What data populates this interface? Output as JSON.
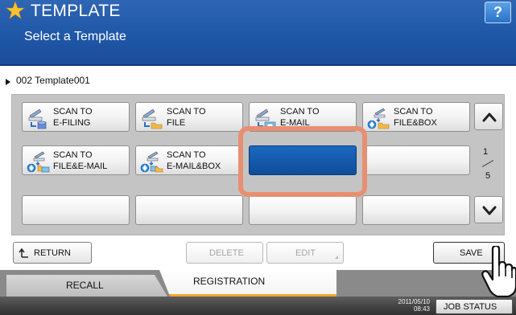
{
  "header": {
    "title": "TEMPLATE",
    "subtitle": "Select a Template",
    "help_label": "?"
  },
  "template_name": "002 Template001",
  "tiles": [
    {
      "line1": "SCAN TO",
      "line2": "E-FILING",
      "icon": "scan-efiling-icon"
    },
    {
      "line1": "SCAN TO",
      "line2": "FILE",
      "icon": "scan-file-icon"
    },
    {
      "line1": "SCAN TO",
      "line2": "E-MAIL",
      "icon": "scan-email-icon"
    },
    {
      "line1": "SCAN TO",
      "line2": "FILE&BOX",
      "icon": "scan-filebox-icon"
    },
    {
      "line1": "SCAN TO",
      "line2": "FILE&E-MAIL",
      "icon": "scan-file-email-icon"
    },
    {
      "line1": "SCAN TO",
      "line2": "E-MAIL&BOX",
      "icon": "scan-email-box-icon"
    },
    {
      "line1": "",
      "line2": "",
      "selected": true
    },
    {
      "line1": "",
      "line2": ""
    },
    {
      "line1": "",
      "line2": ""
    },
    {
      "line1": "",
      "line2": ""
    },
    {
      "line1": "",
      "line2": ""
    },
    {
      "line1": "",
      "line2": ""
    }
  ],
  "pager": {
    "current": "1",
    "total": "5"
  },
  "buttons": {
    "return": "RETURN",
    "delete": "DELETE",
    "edit": "EDIT",
    "save": "SAVE"
  },
  "tabs": {
    "recall": "RECALL",
    "registration": "REGISTRATION"
  },
  "status": {
    "date": "2011/05/10",
    "time": "08:43",
    "job_status": "JOB STATUS"
  },
  "colors": {
    "header_blue": "#2458a6",
    "selected_tile": "#1560b5",
    "highlight": "#e98f71",
    "tab_accent": "#f0a830"
  }
}
